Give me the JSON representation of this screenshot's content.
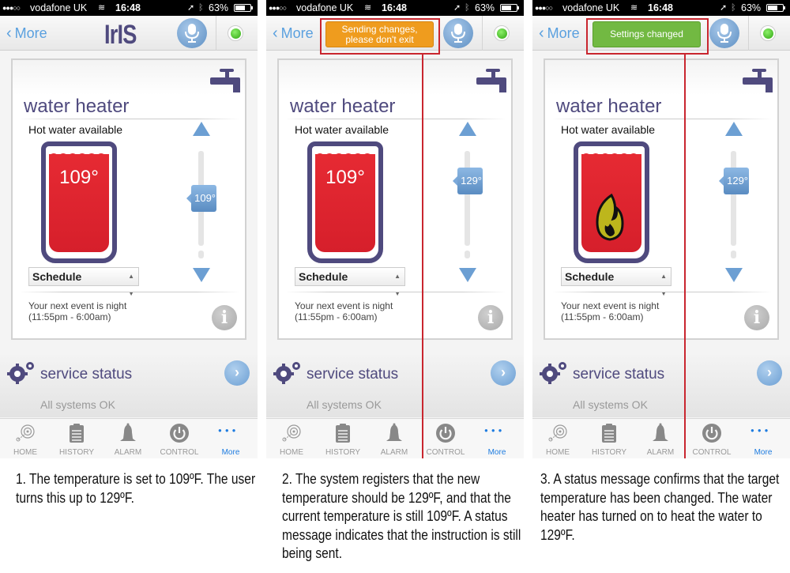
{
  "status_bar": {
    "signal": "●●●○○",
    "carrier": "vodafone UK",
    "wifi_icon": "wifi-icon",
    "time": "16:48",
    "location_icon": "location-arrow-icon",
    "bluetooth_icon": "bluetooth-icon",
    "battery": "63%"
  },
  "nav": {
    "back_label": "More",
    "back_chevron": "‹",
    "logo": "IrIS",
    "mic_icon": "microphone-icon",
    "status_led": "online"
  },
  "card": {
    "title": "water heater",
    "icon": "tap-icon",
    "hot_water_label": "Hot water available",
    "mode_select": "Schedule",
    "select_arrows": "▲▼",
    "next_event_line1": "Your next event is night",
    "next_event_line2": "(11:55pm - 6:00am)",
    "info_icon": "i"
  },
  "service": {
    "title": "service status",
    "status": "All systems OK",
    "chevron": "›"
  },
  "tabs": [
    {
      "label": "HOME",
      "icon": "home-radar-icon"
    },
    {
      "label": "HISTORY",
      "icon": "clipboard-icon"
    },
    {
      "label": "ALARM",
      "icon": "bell-icon"
    },
    {
      "label": "CONTROL",
      "icon": "power-icon"
    },
    {
      "label": "More",
      "icon": "more-dots-icon",
      "active": true
    }
  ],
  "panels": [
    {
      "step": 1,
      "current_temp": "109°",
      "target_temp": "109°",
      "target_value_f": 109,
      "heating": false,
      "toast": null,
      "caption": "1. The temperature is set to 109ºF. The user turns this up to 129ºF."
    },
    {
      "step": 2,
      "current_temp": "109°",
      "target_temp": "129°",
      "target_value_f": 129,
      "heating": false,
      "toast": "Sending changes, please don't exit",
      "toast_color": "#ef9c1e",
      "caption": "2. The system registers that the new temperature should be 129ºF, and that the current temperature is still 109ºF. A status message indicates that the instruction is still being sent."
    },
    {
      "step": 3,
      "current_temp": null,
      "target_temp": "129°",
      "target_value_f": 129,
      "heating": true,
      "toast": "Settings changed",
      "toast_color": "#72b942",
      "caption": "3. A status message confirms that the target temperature has been changed. The water heater has turned on to heat the water to 129ºF."
    }
  ],
  "colors": {
    "brand_purple": "#4f4a7e",
    "accent_blue": "#6c9fd3",
    "tank_red": "#e62a33",
    "annotation_red": "#c9262f",
    "ios_blue": "#1e7ce0"
  }
}
